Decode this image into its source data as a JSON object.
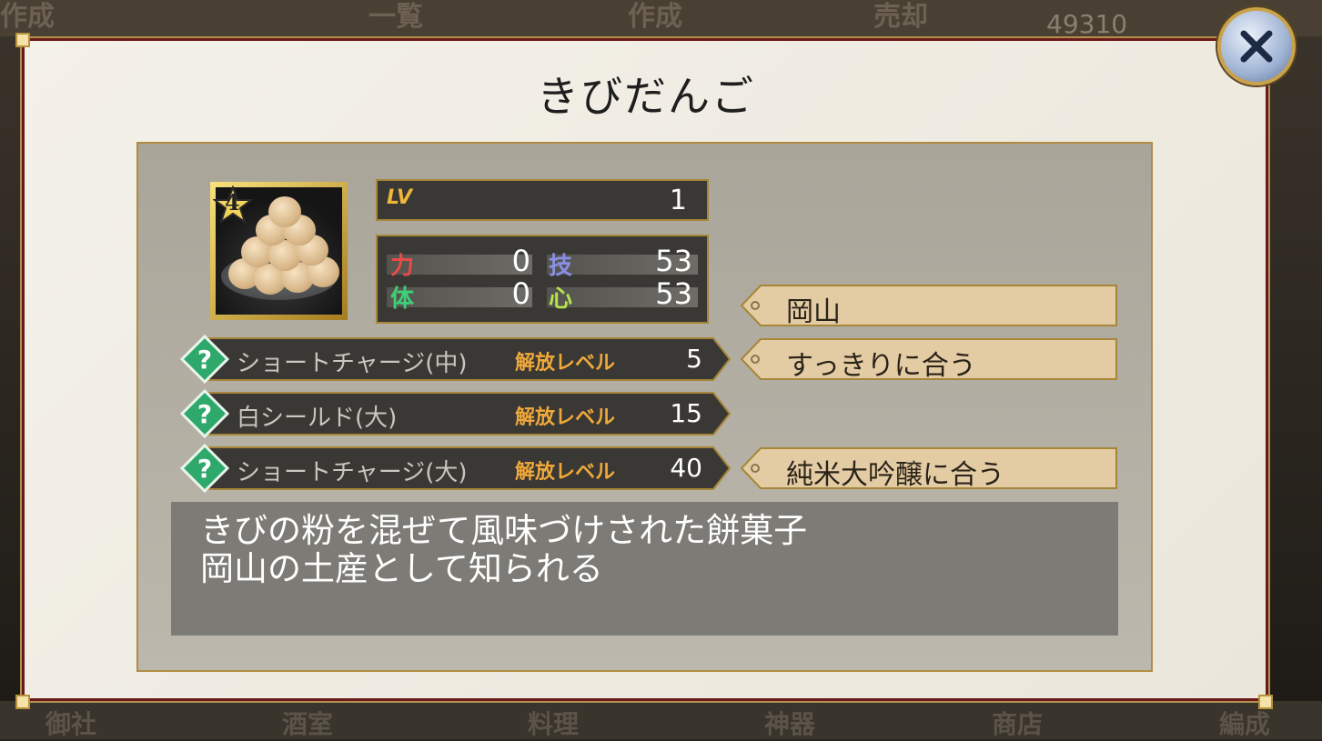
{
  "background": {
    "tabs": [
      "一覧",
      "作成",
      "売却"
    ],
    "bottom_tabs": [
      "御社",
      "酒室",
      "料理",
      "神器",
      "商店",
      "編成"
    ],
    "gold": "49310",
    "corner_title": "作成"
  },
  "dialog": {
    "title": "きびだんご",
    "close_label": "×"
  },
  "item": {
    "rarity": "4",
    "level_label": "LV",
    "level": "1",
    "stats": {
      "power_label": "力",
      "power": "0",
      "skill_label": "技",
      "skill": "53",
      "body_label": "体",
      "body": "0",
      "heart_label": "心",
      "heart": "53"
    }
  },
  "skills": [
    {
      "icon": "question-icon",
      "name": "ショートチャージ(中)",
      "unlock_label": "解放レベル",
      "unlock_level": "5"
    },
    {
      "icon": "question-icon",
      "name": "白シールド(大)",
      "unlock_label": "解放レベル",
      "unlock_level": "15"
    },
    {
      "icon": "question-icon",
      "name": "ショートチャージ(大)",
      "unlock_label": "解放レベル",
      "unlock_level": "40"
    }
  ],
  "tags": [
    "岡山",
    "すっきりに合う",
    "純米大吟醸に合う"
  ],
  "description": {
    "line1": "きびの粉を混ぜて風味づけされた餅菓子",
    "line2": "岡山の土産として知られる"
  },
  "colors": {
    "panel_border": "#b08c43",
    "label_orange": "#f0a83a",
    "tag_bg": "#e3cba4",
    "skill_icon": "#2fa86b"
  }
}
